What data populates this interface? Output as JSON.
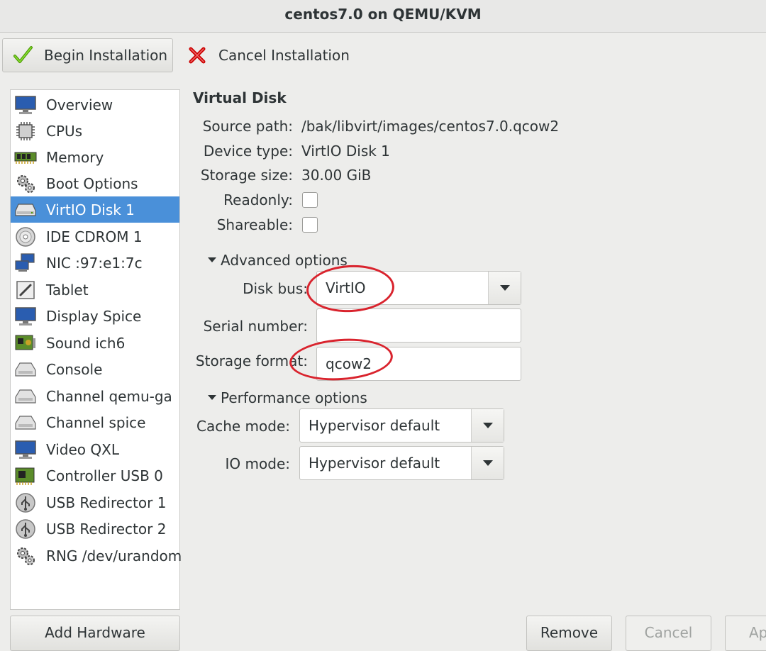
{
  "window": {
    "title": "centos7.0 on QEMU/KVM"
  },
  "toolbar": {
    "begin_label": "Begin Installation",
    "begin_icon": "checkmark-icon",
    "cancel_label": "Cancel Installation",
    "cancel_icon": "red-x-icon"
  },
  "sidebar": {
    "items": [
      {
        "label": "Overview",
        "icon": "monitor-icon"
      },
      {
        "label": "CPUs",
        "icon": "cpu-chip-icon"
      },
      {
        "label": "Memory",
        "icon": "memory-module-icon"
      },
      {
        "label": "Boot Options",
        "icon": "gears-icon"
      },
      {
        "label": "VirtIO Disk 1",
        "icon": "hard-disk-icon",
        "selected": true
      },
      {
        "label": "IDE CDROM 1",
        "icon": "cdrom-icon"
      },
      {
        "label": "NIC :97:e1:7c",
        "icon": "network-icon"
      },
      {
        "label": "Tablet",
        "icon": "tablet-icon"
      },
      {
        "label": "Display Spice",
        "icon": "display-icon"
      },
      {
        "label": "Sound ich6",
        "icon": "sound-card-icon"
      },
      {
        "label": "Console",
        "icon": "serial-port-icon"
      },
      {
        "label": "Channel qemu-ga",
        "icon": "serial-port-icon"
      },
      {
        "label": "Channel spice",
        "icon": "serial-port-icon"
      },
      {
        "label": "Video QXL",
        "icon": "display-icon"
      },
      {
        "label": "Controller USB 0",
        "icon": "controller-card-icon"
      },
      {
        "label": "USB Redirector 1",
        "icon": "usb-icon"
      },
      {
        "label": "USB Redirector 2",
        "icon": "usb-icon"
      },
      {
        "label": "RNG /dev/urandom",
        "icon": "gears-icon"
      }
    ]
  },
  "details": {
    "title": "Virtual Disk",
    "source_path_label": "Source path:",
    "source_path": "/bak/libvirt/images/centos7.0.qcow2",
    "device_type_label": "Device type:",
    "device_type": "VirtIO Disk 1",
    "storage_size_label": "Storage size:",
    "storage_size": "30.00 GiB",
    "readonly_label": "Readonly:",
    "readonly_checked": false,
    "shareable_label": "Shareable:",
    "shareable_checked": false,
    "advanced_label": "Advanced options",
    "disk_bus_label": "Disk bus:",
    "disk_bus": "VirtIO",
    "serial_label": "Serial number:",
    "serial": "",
    "storage_format_label": "Storage format:",
    "storage_format": "qcow2",
    "performance_label": "Performance options",
    "cache_mode_label": "Cache mode:",
    "cache_mode": "Hypervisor default",
    "io_mode_label": "IO mode:",
    "io_mode": "Hypervisor default"
  },
  "buttons": {
    "add_hardware": "Add Hardware",
    "remove": "Remove",
    "cancel": "Cancel",
    "apply": "Apply"
  },
  "colors": {
    "selection": "#4a90d9",
    "annotation": "#d9232d"
  }
}
